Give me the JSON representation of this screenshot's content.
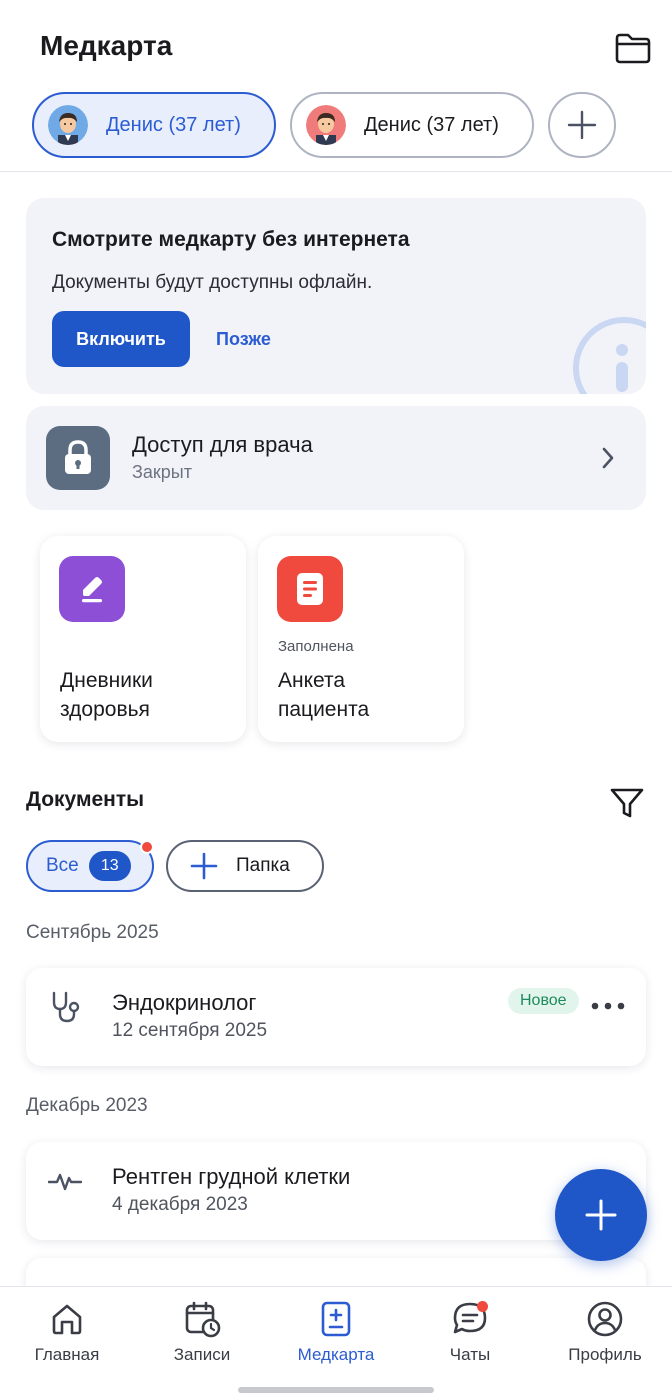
{
  "header": {
    "title": "Медкарта",
    "profiles": [
      {
        "label": "Денис (37 лет)",
        "active": true
      },
      {
        "label": "Денис (37 лет)",
        "active": false
      }
    ]
  },
  "offline_banner": {
    "title": "Смотрите медкарту без интернета",
    "text": "Документы будут доступны офлайн.",
    "enable_label": "Включить",
    "later_label": "Позже"
  },
  "doctor_access": {
    "title": "Доступ для врача",
    "status": "Закрыт"
  },
  "tiles": [
    {
      "sub": "",
      "label_line1": "Дневники",
      "label_line2": "здоровья"
    },
    {
      "sub": "Заполнена",
      "label_line1": "Анкета",
      "label_line2": "пациента"
    }
  ],
  "documents": {
    "title": "Документы",
    "filters": {
      "all_label": "Все",
      "all_count": "13",
      "folder_label": "Папка"
    },
    "groups": [
      {
        "month": "Сентябрь 2025",
        "items": [
          {
            "title": "Эндокринолог",
            "date": "12 сентября 2025",
            "badge": "Новое"
          }
        ]
      },
      {
        "month": "Декабрь 2023",
        "items": [
          {
            "title": "Рентген грудной клетки",
            "date": "4 декабря 2023"
          }
        ]
      }
    ]
  },
  "bottom_nav": [
    {
      "label": "Главная",
      "icon": "home-icon"
    },
    {
      "label": "Записи",
      "icon": "calendar-clock-icon"
    },
    {
      "label": "Медкарта",
      "icon": "medcard-icon",
      "active": true
    },
    {
      "label": "Чаты",
      "icon": "chat-icon"
    },
    {
      "label": "Профиль",
      "icon": "profile-icon"
    }
  ],
  "colors": {
    "accent": "#1f56c8",
    "accent_text": "#2b5cd1",
    "card_bg": "#f1f3f9",
    "diary_icon_bg": "#8d4fd6",
    "form_icon_bg": "#f04a3e",
    "new_badge_bg": "#e2f5ec",
    "new_badge_text": "#1f8a5b"
  }
}
